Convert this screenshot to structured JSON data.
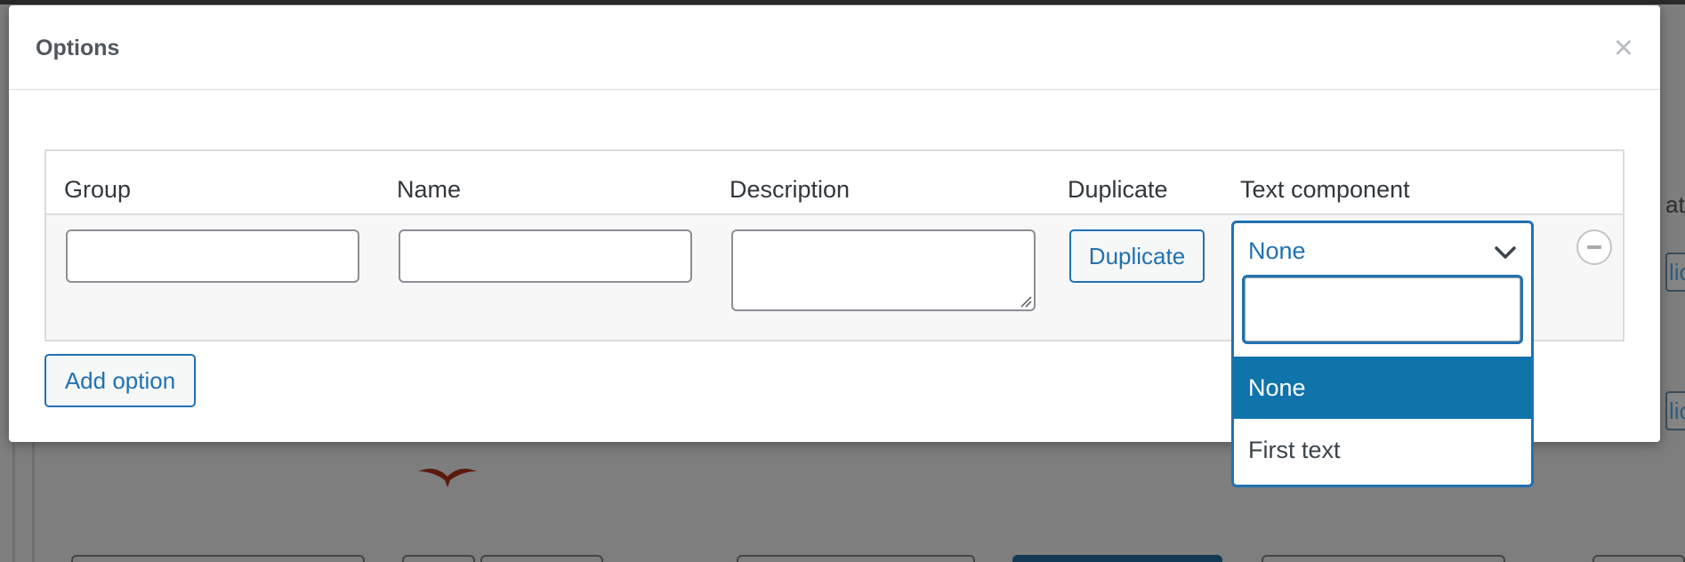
{
  "modal": {
    "title": "Options",
    "close_symbol": "×"
  },
  "table": {
    "columns": [
      "Group",
      "Name",
      "Description",
      "Duplicate",
      "Text component"
    ],
    "row": {
      "group_value": "",
      "name_value": "",
      "description_value": "",
      "duplicate_button_label": "Duplicate",
      "text_component_selected": "None"
    }
  },
  "dropdown": {
    "search_value": "",
    "options": [
      "None",
      "First text"
    ],
    "selected_index": 0
  },
  "add_option_label": "Add option",
  "background": {
    "peek_text_1": "ate",
    "peek_button_1": "lica",
    "peek_button_2": "lica"
  },
  "icons": {
    "close": "close-icon",
    "chevron": "chevron-down-icon",
    "remove": "minus-circle-icon",
    "resize": "resize-grip-icon",
    "bird": "bird-image"
  },
  "colors": {
    "accent": "#2271b1",
    "selected_option_bg": "#1073aa",
    "overlay": "#7e7e7e",
    "row_bg": "#f7f7f7"
  }
}
